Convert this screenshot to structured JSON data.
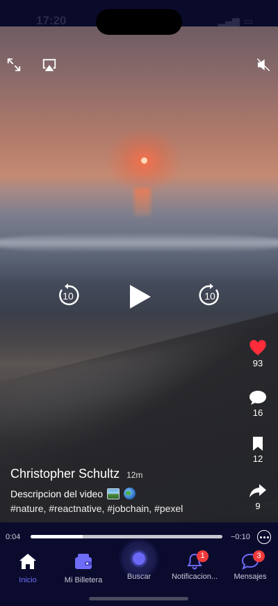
{
  "status_bar": {
    "time": "17:20"
  },
  "video": {
    "author": "Christopher Schultz",
    "age": "12m",
    "description": "Descripcion del video",
    "tags": "#nature, #reactnative, #jobchain, #pexel",
    "skip_back_label": "10",
    "skip_forward_label": "10",
    "likes": "93",
    "comments": "16",
    "saves": "12",
    "shares": "9",
    "accent_like": "#ff2d3a"
  },
  "player": {
    "current_time": "0:04",
    "remaining_time": "−0:10",
    "progress": 0.27
  },
  "tabs": [
    {
      "label": "Inicio",
      "icon": "home-icon",
      "active": true
    },
    {
      "label": "Mi Billetera",
      "icon": "wallet-icon",
      "active": false
    },
    {
      "label": "Buscar",
      "icon": "search-orb-icon",
      "active": false
    },
    {
      "label": "Notificacion...",
      "icon": "bell-icon",
      "badge": "1",
      "active": false
    },
    {
      "label": "Mensajes",
      "icon": "chat-icon",
      "badge": "3",
      "active": false
    }
  ]
}
